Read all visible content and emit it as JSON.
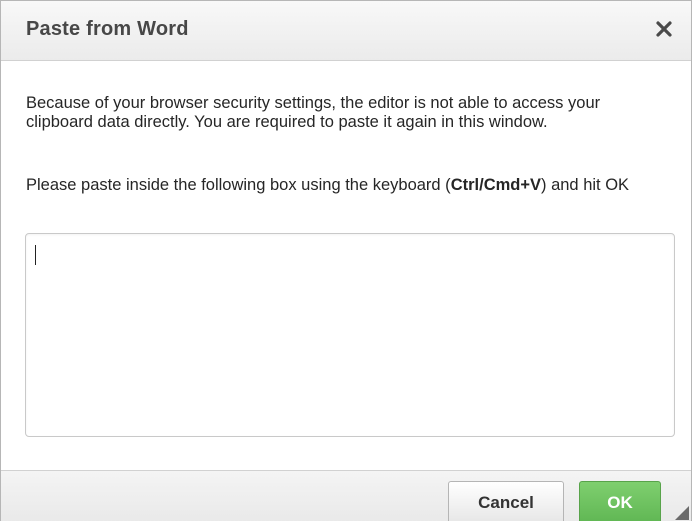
{
  "dialog": {
    "title": "Paste from Word",
    "close_icon": "close-icon"
  },
  "body": {
    "paragraph1": "Because of your browser security settings, the editor is not able to access your clipboard data directly. You are required to paste it again in this window.",
    "paragraph2_prefix": "Please paste inside the following box using the keyboard (",
    "paragraph2_shortcut": "Ctrl/Cmd+V",
    "paragraph2_suffix": ") and hit OK",
    "paste_box_value": ""
  },
  "footer": {
    "cancel_label": "Cancel",
    "ok_label": "OK"
  },
  "colors": {
    "ok_button": "#6cc45c",
    "title_text": "#474747"
  }
}
